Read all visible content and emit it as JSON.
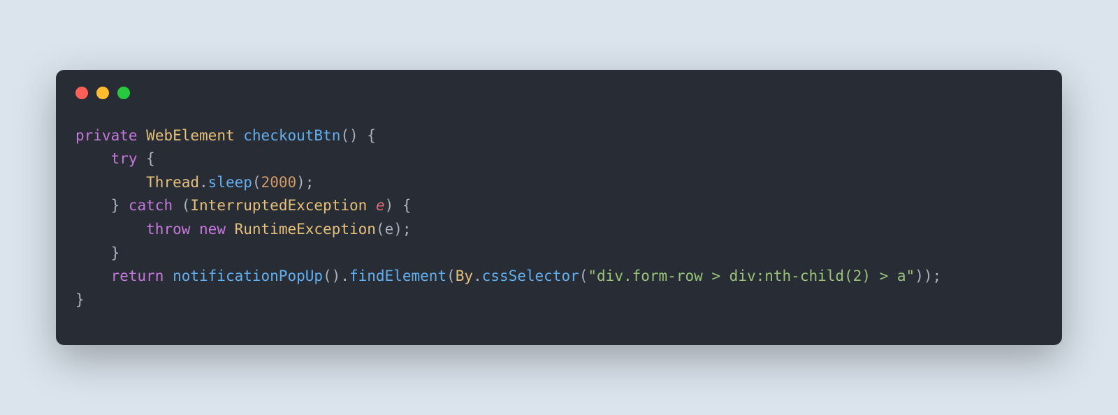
{
  "code": {
    "line1": {
      "private": "private",
      "webElement": "WebElement",
      "checkoutBtn": "checkoutBtn",
      "parenOpen": "()",
      "brace": " {"
    },
    "line2": {
      "indent": "    ",
      "try": "try",
      "brace": " {"
    },
    "line3": {
      "indent": "        ",
      "thread": "Thread",
      "dot": ".",
      "sleep": "sleep",
      "open": "(",
      "num": "2000",
      "close": ");"
    },
    "line4": {
      "indent": "    ",
      "closeBrace": "} ",
      "catch": "catch",
      "open": " (",
      "exType": "InterruptedException",
      "space": " ",
      "e": "e",
      "close": ") {"
    },
    "line5": {
      "indent": "        ",
      "throw": "throw",
      "space": " ",
      "new": "new",
      "rtType": " RuntimeException",
      "open": "(",
      "e": "e",
      "close": ");"
    },
    "line6": {
      "indent": "    ",
      "close": "}"
    },
    "line7": {
      "indent": "    ",
      "return": "return",
      "space": " ",
      "notifPopup": "notificationPopUp",
      "call1": "().",
      "findElement": "findElement",
      "open": "(",
      "by": "By",
      "dot": ".",
      "cssSelector": "cssSelector",
      "open2": "(",
      "str": "\"div.form-row > div:nth-child(2) > a\"",
      "close": "));"
    },
    "line8": {
      "close": "}"
    }
  }
}
